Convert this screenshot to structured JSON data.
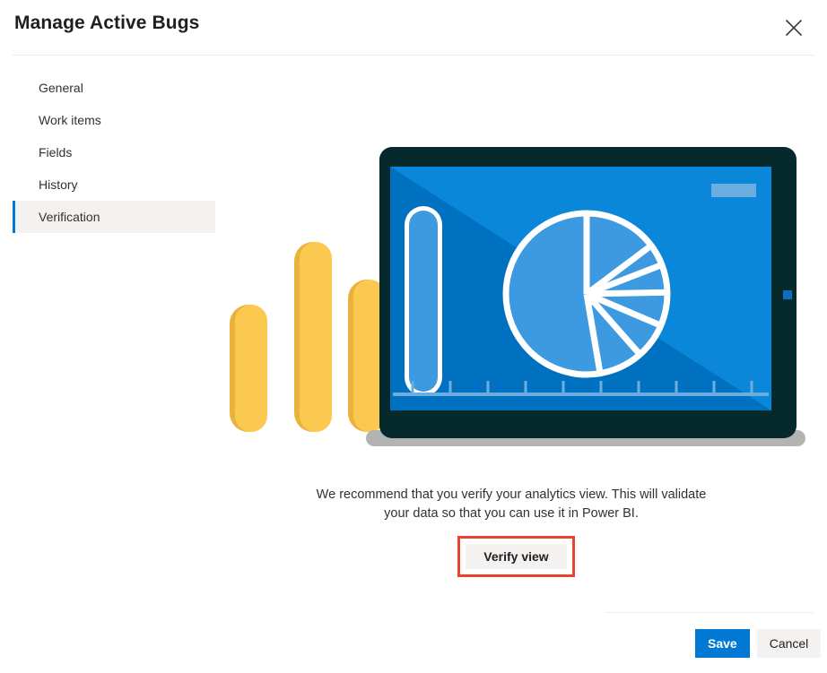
{
  "dialog": {
    "title": "Manage Active Bugs",
    "close_icon": "close-icon"
  },
  "sidebar": {
    "items": [
      {
        "label": "General",
        "selected": false
      },
      {
        "label": "Work items",
        "selected": false
      },
      {
        "label": "Fields",
        "selected": false
      },
      {
        "label": "History",
        "selected": false
      },
      {
        "label": "Verification",
        "selected": true
      }
    ]
  },
  "main": {
    "illustration_name": "analytics-dashboard-illustration",
    "recommend_text": "We recommend that you verify your analytics view. This will validate your data so that you can use it in Power BI.",
    "verify_button_label": "Verify view",
    "annotation_color": "#e8432c"
  },
  "footer": {
    "save_label": "Save",
    "cancel_label": "Cancel"
  },
  "colors": {
    "accent": "#0078d4",
    "selected_nav_background": "#f3f2f1",
    "screen_blue": "#0070c0",
    "screen_highlight_blue": "#0a87d8",
    "chart_light_blue": "#3d9ae0",
    "bezel_dark": "#06292b",
    "bar_yellow": "#fbc850",
    "bar_yellow_shadow": "#eab23c",
    "stand_gray": "#b3b3b3"
  }
}
